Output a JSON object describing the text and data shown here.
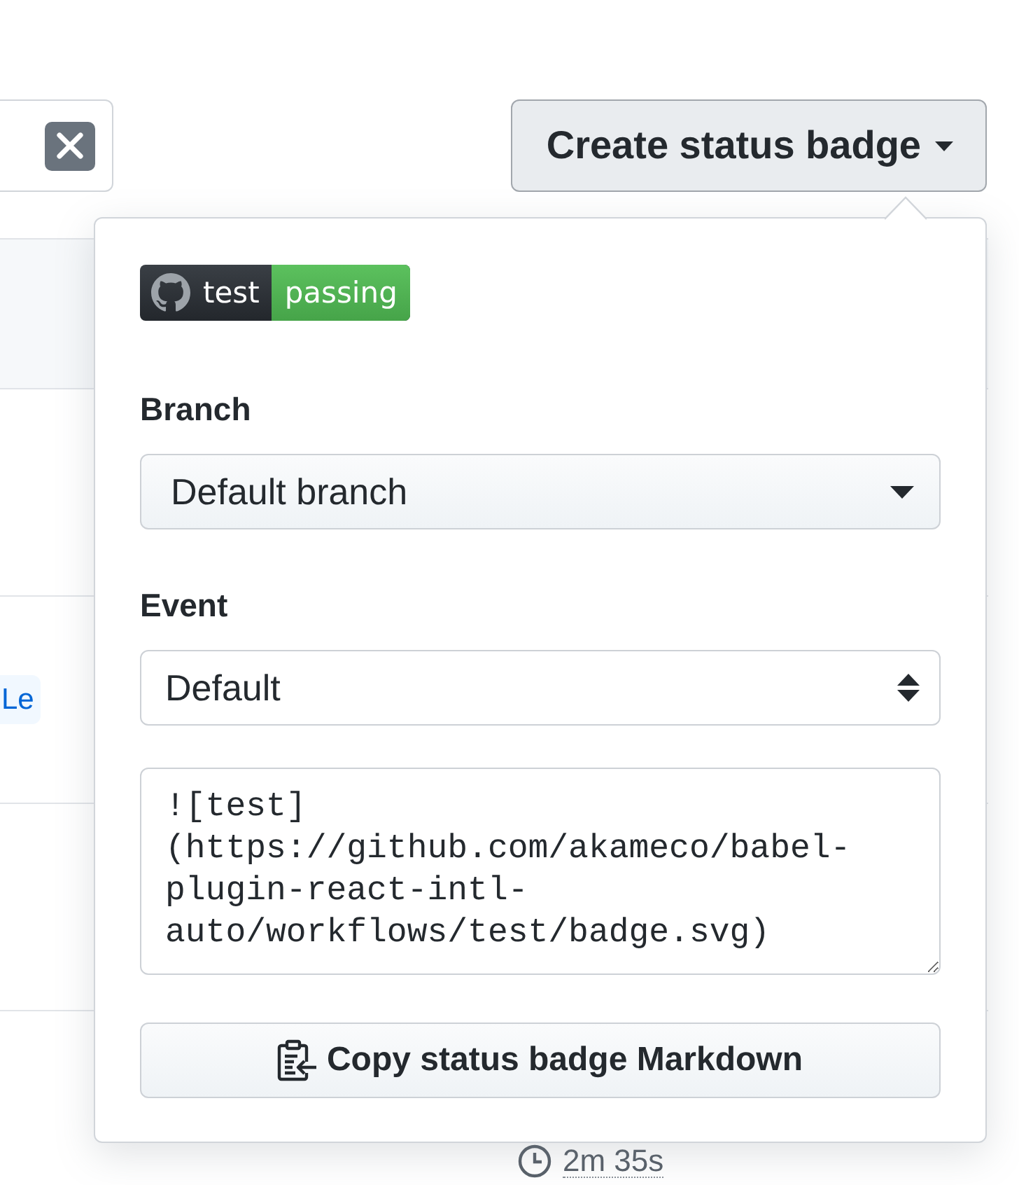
{
  "toolbar": {
    "badge_button": {
      "label": "Create status badge",
      "expanded": true
    },
    "badge_menu": {
      "badge": {
        "name": "test",
        "status": "passing"
      },
      "fields": [
        {
          "kind": "menu",
          "label": "Branch",
          "value": "Default branch"
        },
        {
          "kind": "select",
          "label": "Event",
          "value": "Default"
        }
      ],
      "markdown": "![test](https://github.com/akameco/babel-plugin-react-intl-auto/workflows/test/badge.svg)",
      "copy_button": "Copy status badge Markdown"
    }
  },
  "runs": [
    {
      "kind": "header"
    },
    {
      "kind": "run"
    },
    {
      "kind": "run",
      "label": "Le"
    },
    {
      "kind": "run"
    },
    {
      "kind": "run",
      "duration": "2m 35s"
    }
  ]
}
